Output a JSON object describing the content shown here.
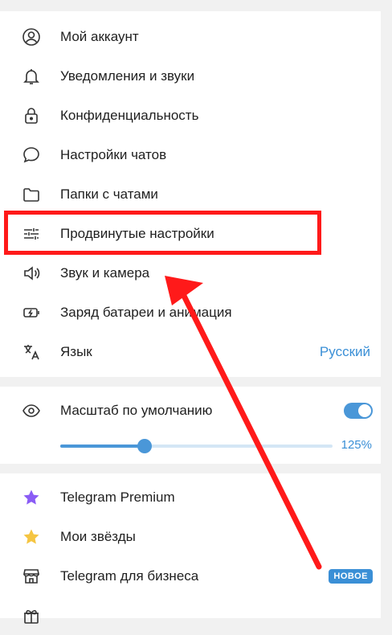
{
  "menu_main": {
    "items": [
      {
        "label": "Мой аккаунт",
        "icon": "account-circle-icon"
      },
      {
        "label": "Уведомления и звуки",
        "icon": "bell-icon"
      },
      {
        "label": "Конфиденциальность",
        "icon": "lock-icon"
      },
      {
        "label": "Настройки чатов",
        "icon": "chat-bubble-icon"
      },
      {
        "label": "Папки с чатами",
        "icon": "folder-icon"
      },
      {
        "label": "Продвинутые настройки",
        "icon": "sliders-icon"
      },
      {
        "label": "Звук и камера",
        "icon": "speaker-icon"
      },
      {
        "label": "Заряд батареи и анимация",
        "icon": "battery-icon"
      },
      {
        "label": "Язык",
        "icon": "translate-icon",
        "value": "Русский"
      }
    ]
  },
  "scale": {
    "label": "Масштаб по умолчанию",
    "icon": "eye-icon",
    "toggle_on": true,
    "value_text": "125%",
    "slider_fraction": 0.31
  },
  "menu_extra": {
    "items": [
      {
        "label": "Telegram Premium",
        "icon": "star-purple-icon"
      },
      {
        "label": "Мои звёзды",
        "icon": "star-yellow-icon"
      },
      {
        "label": "Telegram для бизнеса",
        "icon": "store-icon",
        "badge": "НОВОЕ"
      }
    ]
  },
  "colors": {
    "accent": "#3a8fd6",
    "highlight": "#ff1a1a",
    "premium_star": "#8a5cf5",
    "stars_gold": "#f5c542"
  }
}
